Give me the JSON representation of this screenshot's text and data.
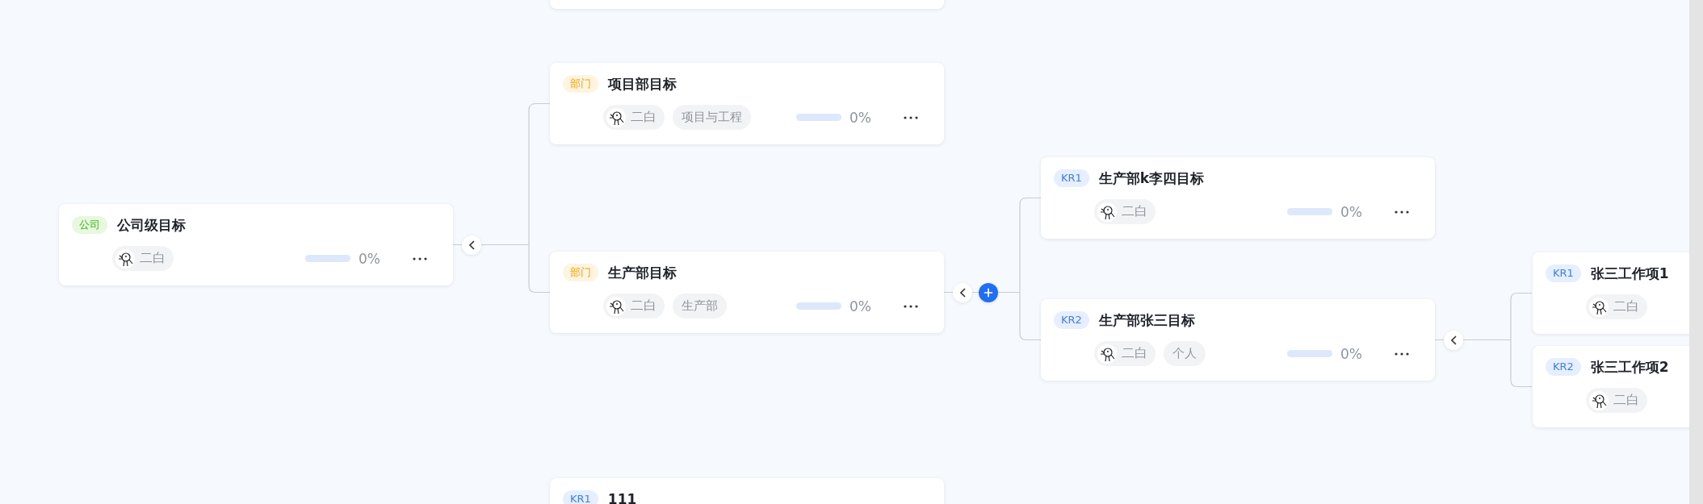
{
  "trees": [
    {
      "tag": {
        "text": "公司",
        "kind": "company"
      },
      "title": "公司级目标",
      "owner": "二白",
      "progress": {
        "level": 0,
        "text": "0%"
      },
      "expanded": true,
      "children": [
        {
          "tag": {
            "text": "部门",
            "kind": "dept"
          },
          "title": "项目部目标",
          "owner": "二白",
          "dept": "项目与工程",
          "progress": {
            "level": 0,
            "text": "0%"
          }
        },
        {
          "tag": {
            "text": "部门",
            "kind": "dept"
          },
          "title": "生产部目标",
          "owner": "二白",
          "dept": "生产部",
          "progress": {
            "level": 0,
            "text": "0%"
          },
          "expanded": true,
          "add_button": true,
          "children": [
            {
              "tag": {
                "text": "KR1",
                "kind": "kr"
              },
              "title": "生产部k李四目标",
              "owner": "二白",
              "progress": {
                "level": 0,
                "text": "0%"
              }
            },
            {
              "tag": {
                "text": "KR2",
                "kind": "kr"
              },
              "title": "生产部张三目标",
              "owner": "二白",
              "dept": "个人",
              "progress": {
                "level": 0,
                "text": "0%"
              },
              "expanded": true,
              "children": [
                {
                  "tag": {
                    "text": "KR1",
                    "kind": "kr"
                  },
                  "title": "张三工作项1",
                  "owner": "二白"
                },
                {
                  "tag": {
                    "text": "KR2",
                    "kind": "kr"
                  },
                  "title": "张三工作项2",
                  "owner": "二白"
                }
              ]
            }
          ]
        }
      ]
    },
    {
      "tag": {
        "text": "KR1",
        "kind": "kr"
      },
      "title": "111"
    }
  ]
}
